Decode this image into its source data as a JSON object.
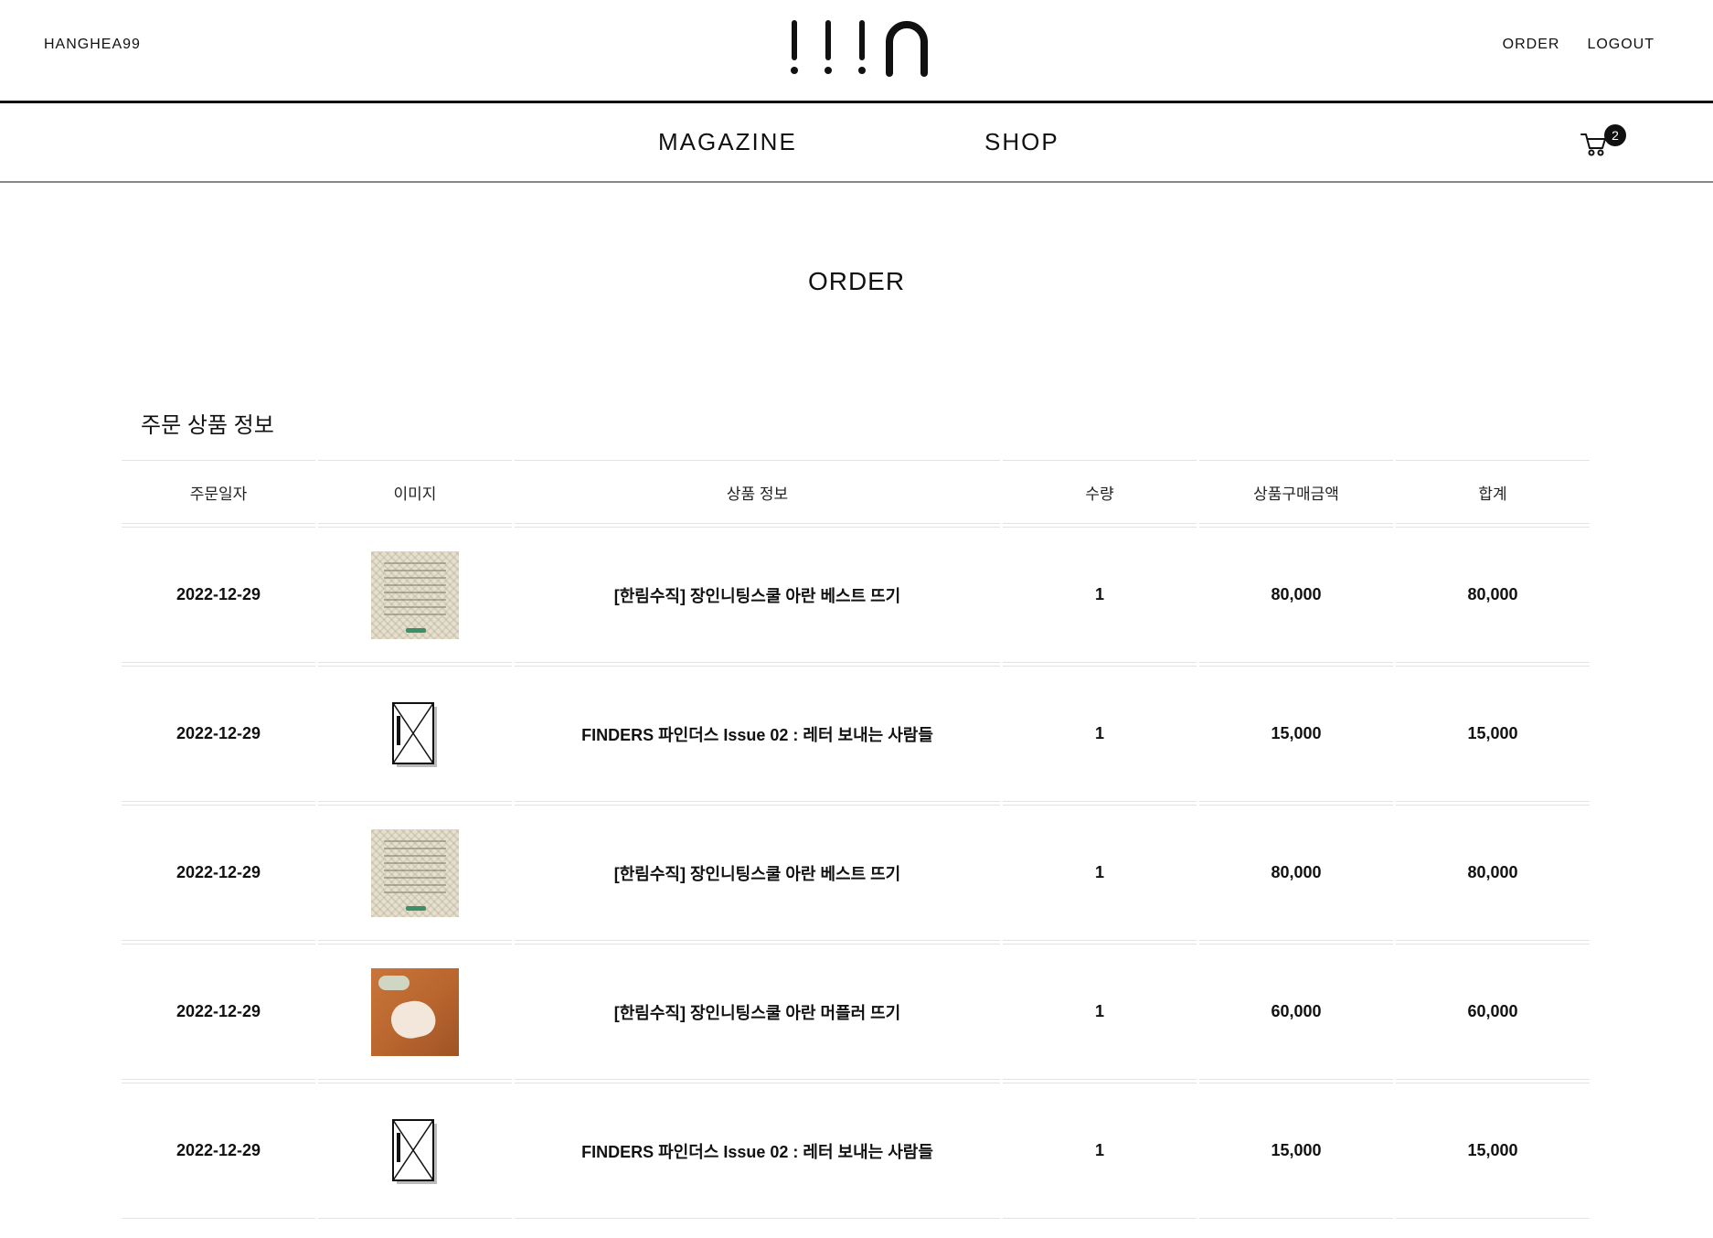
{
  "header": {
    "username": "HANGHEA99",
    "order_link": "ORDER",
    "logout_link": "LOGOUT"
  },
  "nav": {
    "magazine": "MAGAZINE",
    "shop": "SHOP",
    "cart_count": "2"
  },
  "page": {
    "title": "ORDER",
    "section_title": "주문 상품 정보"
  },
  "table": {
    "columns": [
      "주문일자",
      "이미지",
      "상품 정보",
      "수량",
      "상품구매금액",
      "합계"
    ],
    "rows": [
      {
        "date": "2022-12-29",
        "image": "knit-vest-thumbnail",
        "product": "[한림수직] 장인니팅스쿨 아란 베스트 뜨기",
        "qty": "1",
        "price": "80,000",
        "total": "80,000"
      },
      {
        "date": "2022-12-29",
        "image": "finders-envelope-thumbnail",
        "product": "FINDERS 파인더스 Issue 02 : 레터 보내는 사람들",
        "qty": "1",
        "price": "15,000",
        "total": "15,000"
      },
      {
        "date": "2022-12-29",
        "image": "knit-vest-thumbnail",
        "product": "[한림수직] 장인니팅스쿨 아란 베스트 뜨기",
        "qty": "1",
        "price": "80,000",
        "total": "80,000"
      },
      {
        "date": "2022-12-29",
        "image": "knit-muffler-thumbnail",
        "product": "[한림수직] 장인니팅스쿨 아란 머플러 뜨기",
        "qty": "1",
        "price": "60,000",
        "total": "60,000"
      },
      {
        "date": "2022-12-29",
        "image": "finders-envelope-thumbnail",
        "product": "FINDERS 파인더스 Issue 02 : 레터 보내는 사람들",
        "qty": "1",
        "price": "15,000",
        "total": "15,000"
      }
    ]
  }
}
